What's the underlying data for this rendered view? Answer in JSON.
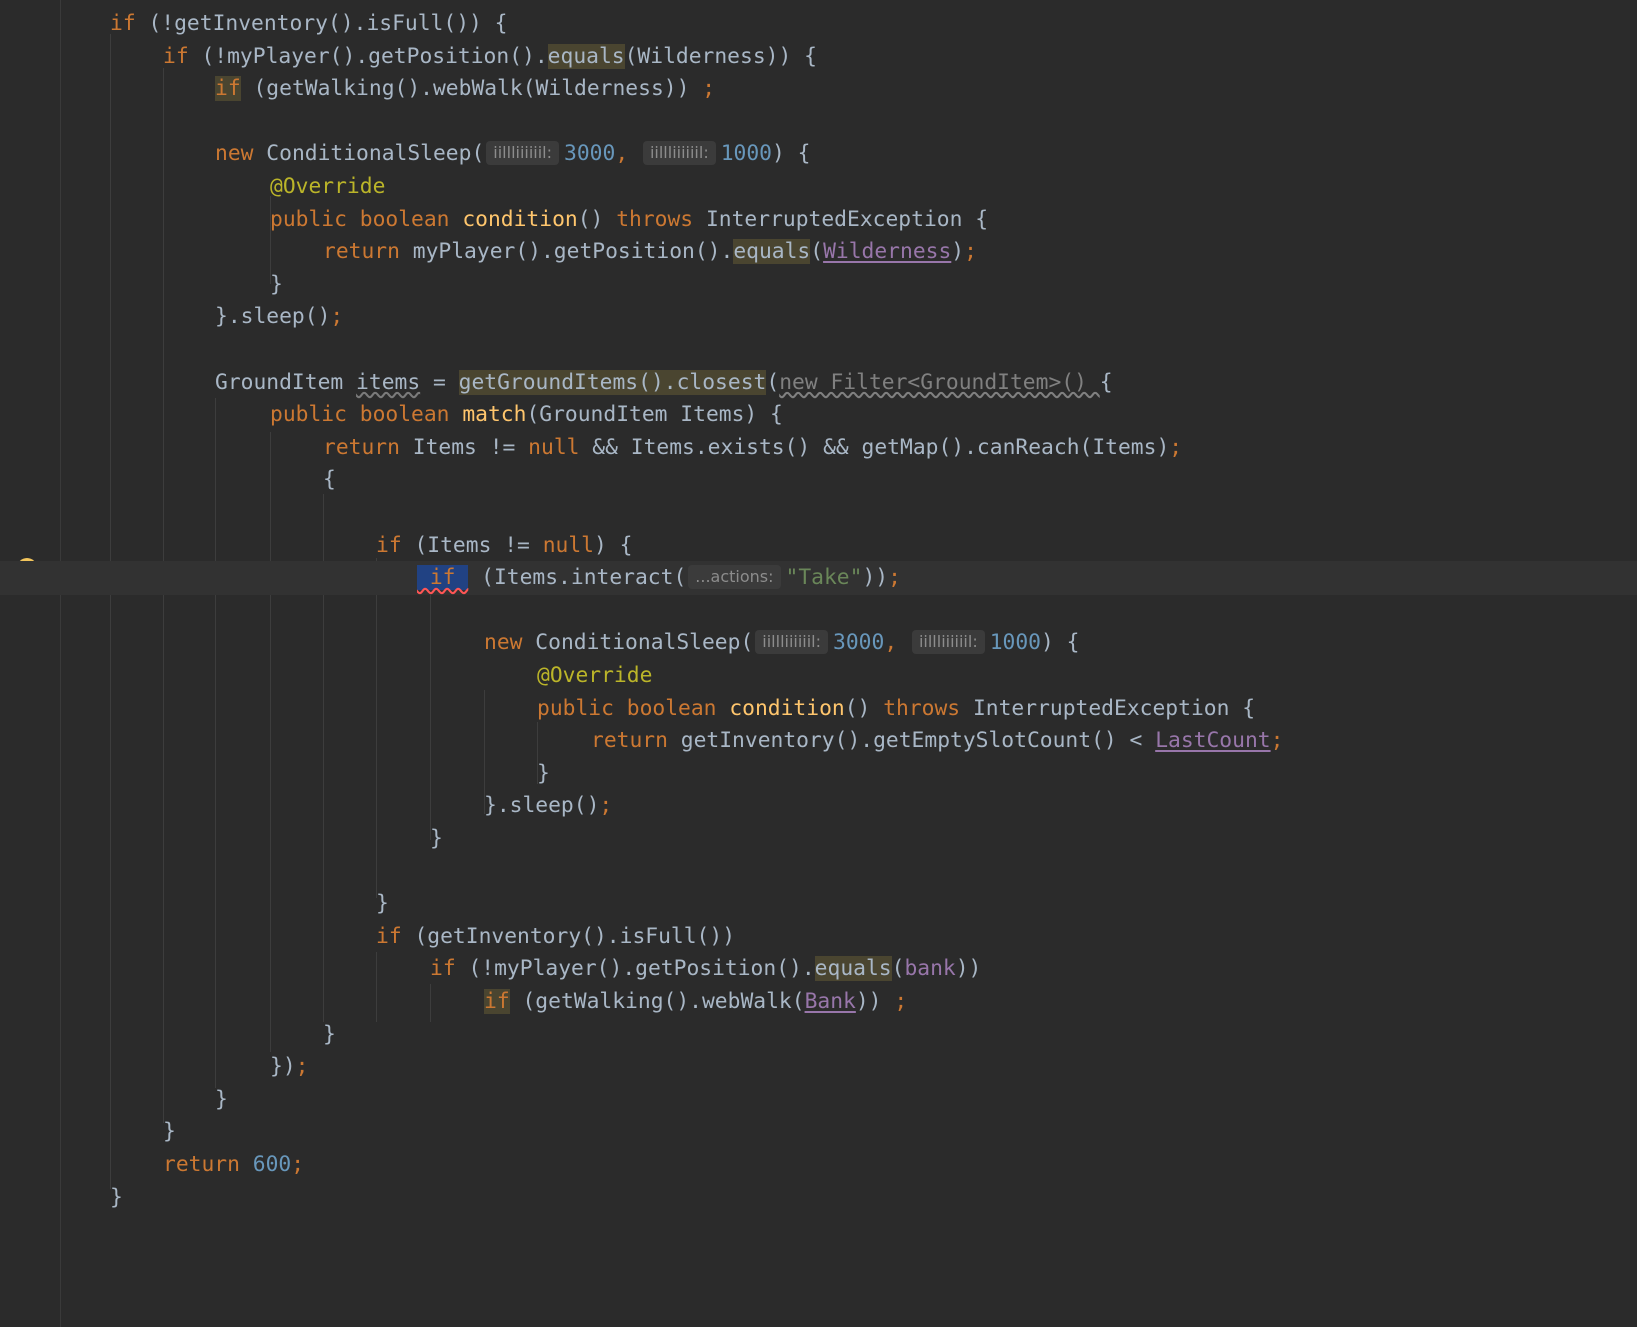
{
  "editor": {
    "colors": {
      "background": "#2b2b2b",
      "keyword": "#cc7832",
      "identifier": "#a9b7c6",
      "method": "#ffc66d",
      "number": "#6897bb",
      "string": "#6a8759",
      "annotation": "#bbb529",
      "field": "#9876aa",
      "selection": "#214283",
      "usage_highlight": "#4a4530"
    },
    "gutter_icon": "intention-bulb-icon",
    "current_line": 17,
    "lines": [
      {
        "i": 50,
        "t": [
          [
            "kw",
            "if "
          ],
          [
            "id",
            "(!getInventory().isFull()) {"
          ]
        ]
      },
      {
        "i": 103,
        "t": [
          [
            "kw",
            "if "
          ],
          [
            "id",
            "(!myPlayer().getPosition()."
          ],
          [
            "hl",
            "equals"
          ],
          [
            "id",
            "(Wilderness)) {"
          ]
        ]
      },
      {
        "i": 155,
        "t": [
          [
            "hlk",
            "if"
          ],
          [
            "id",
            " (getWalking().webWalk(Wilderness)) "
          ],
          [
            "kw",
            ";"
          ]
        ]
      },
      {
        "i": 0,
        "t": []
      },
      {
        "i": 155,
        "t": [
          [
            "kw",
            "new "
          ],
          [
            "id",
            "ConditionalSleep("
          ],
          [
            "hint",
            "iillliiiiiil:"
          ],
          [
            "num",
            "3000"
          ],
          [
            "kw",
            ", "
          ],
          [
            "hint",
            "iillliiiiiil:"
          ],
          [
            "num",
            "1000"
          ],
          [
            "id",
            ") {"
          ]
        ]
      },
      {
        "i": 210,
        "t": [
          [
            "ann",
            "@Override"
          ]
        ]
      },
      {
        "i": 210,
        "t": [
          [
            "kw",
            "public boolean "
          ],
          [
            "fn",
            "condition"
          ],
          [
            "id",
            "() "
          ],
          [
            "kw",
            "throws "
          ],
          [
            "id",
            "InterruptedException {"
          ]
        ]
      },
      {
        "i": 263,
        "t": [
          [
            "kw",
            "return "
          ],
          [
            "id",
            "myPlayer().getPosition()."
          ],
          [
            "hl",
            "equals"
          ],
          [
            "id",
            "("
          ],
          [
            "fldu",
            "Wilderness"
          ],
          [
            "id",
            ")"
          ],
          [
            "kw",
            ";"
          ]
        ]
      },
      {
        "i": 210,
        "t": [
          [
            "id",
            "}"
          ]
        ]
      },
      {
        "i": 155,
        "t": [
          [
            "id",
            "}.sleep()"
          ],
          [
            "kw",
            ";"
          ]
        ]
      },
      {
        "i": 0,
        "t": []
      },
      {
        "i": 155,
        "t": [
          [
            "id",
            "GroundItem "
          ],
          [
            "varw",
            "items"
          ],
          [
            "id",
            " = "
          ],
          [
            "hl",
            "getGroundItems().closest"
          ],
          [
            "id",
            "("
          ],
          [
            "grayw",
            "new Filter<GroundItem>() "
          ],
          [
            "id",
            "{"
          ]
        ]
      },
      {
        "i": 210,
        "t": [
          [
            "kw",
            "public boolean "
          ],
          [
            "fn",
            "match"
          ],
          [
            "id",
            "(GroundItem Items) {"
          ]
        ]
      },
      {
        "i": 263,
        "t": [
          [
            "kw",
            "return "
          ],
          [
            "id",
            "Items != "
          ],
          [
            "kw",
            "null "
          ],
          [
            "id",
            "&& Items.exists() && getMap().canReach(Items)"
          ],
          [
            "kw",
            ";"
          ]
        ]
      },
      {
        "i": 263,
        "t": [
          [
            "id",
            "{"
          ]
        ]
      },
      {
        "i": 0,
        "t": []
      },
      {
        "i": 316,
        "t": [
          [
            "kw",
            "if "
          ],
          [
            "id",
            "(Items != "
          ],
          [
            "kw",
            "null"
          ],
          [
            "id",
            ") {"
          ]
        ]
      },
      {
        "i": 357,
        "t": [
          [
            "sel",
            " if "
          ],
          [
            "id",
            " (Items.interact("
          ],
          [
            "hint",
            "...actions:"
          ],
          [
            "str",
            "\"Take\""
          ],
          [
            "id",
            "))"
          ],
          [
            "kw",
            ";"
          ]
        ]
      },
      {
        "i": 0,
        "t": []
      },
      {
        "i": 424,
        "t": [
          [
            "kw",
            "new "
          ],
          [
            "id",
            "ConditionalSleep("
          ],
          [
            "hint",
            "iillliiiiiil:"
          ],
          [
            "num",
            "3000"
          ],
          [
            "kw",
            ", "
          ],
          [
            "hint",
            "iillliiiiiil:"
          ],
          [
            "num",
            "1000"
          ],
          [
            "id",
            ") {"
          ]
        ]
      },
      {
        "i": 477,
        "t": [
          [
            "ann",
            "@Override"
          ]
        ]
      },
      {
        "i": 477,
        "t": [
          [
            "kw",
            "public boolean "
          ],
          [
            "fn",
            "condition"
          ],
          [
            "id",
            "() "
          ],
          [
            "kw",
            "throws "
          ],
          [
            "id",
            "InterruptedException {"
          ]
        ]
      },
      {
        "i": 531,
        "t": [
          [
            "kw",
            "return "
          ],
          [
            "id",
            "getInventory().getEmptySlotCount() < "
          ],
          [
            "fldu",
            "LastCount"
          ],
          [
            "kw",
            ";"
          ]
        ]
      },
      {
        "i": 477,
        "t": [
          [
            "id",
            "}"
          ]
        ]
      },
      {
        "i": 424,
        "t": [
          [
            "id",
            "}.sleep()"
          ],
          [
            "kw",
            ";"
          ]
        ]
      },
      {
        "i": 370,
        "t": [
          [
            "id",
            "}"
          ]
        ]
      },
      {
        "i": 0,
        "t": []
      },
      {
        "i": 316,
        "t": [
          [
            "id",
            "}"
          ]
        ]
      },
      {
        "i": 316,
        "t": [
          [
            "kw",
            "if "
          ],
          [
            "id",
            "(getInventory().isFull())"
          ]
        ]
      },
      {
        "i": 370,
        "t": [
          [
            "kw",
            "if "
          ],
          [
            "id",
            "(!myPlayer().getPosition()."
          ],
          [
            "hl",
            "equals"
          ],
          [
            "id",
            "("
          ],
          [
            "fld",
            "bank"
          ],
          [
            "id",
            "))"
          ]
        ]
      },
      {
        "i": 424,
        "t": [
          [
            "hlk",
            "if"
          ],
          [
            "id",
            " (getWalking().webWalk("
          ],
          [
            "fldu",
            "Bank"
          ],
          [
            "id",
            ")) "
          ],
          [
            "kw",
            ";"
          ]
        ]
      },
      {
        "i": 263,
        "t": [
          [
            "id",
            "}"
          ]
        ]
      },
      {
        "i": 210,
        "t": [
          [
            "id",
            "})"
          ],
          [
            "kw",
            ";"
          ]
        ]
      },
      {
        "i": 155,
        "t": [
          [
            "id",
            "}"
          ]
        ]
      },
      {
        "i": 103,
        "t": [
          [
            "id",
            "}"
          ]
        ]
      },
      {
        "i": 103,
        "t": [
          [
            "kw",
            "return "
          ],
          [
            "num",
            "600"
          ],
          [
            "kw",
            ";"
          ]
        ]
      },
      {
        "i": 50,
        "t": [
          [
            "id",
            "}"
          ]
        ]
      }
    ]
  }
}
